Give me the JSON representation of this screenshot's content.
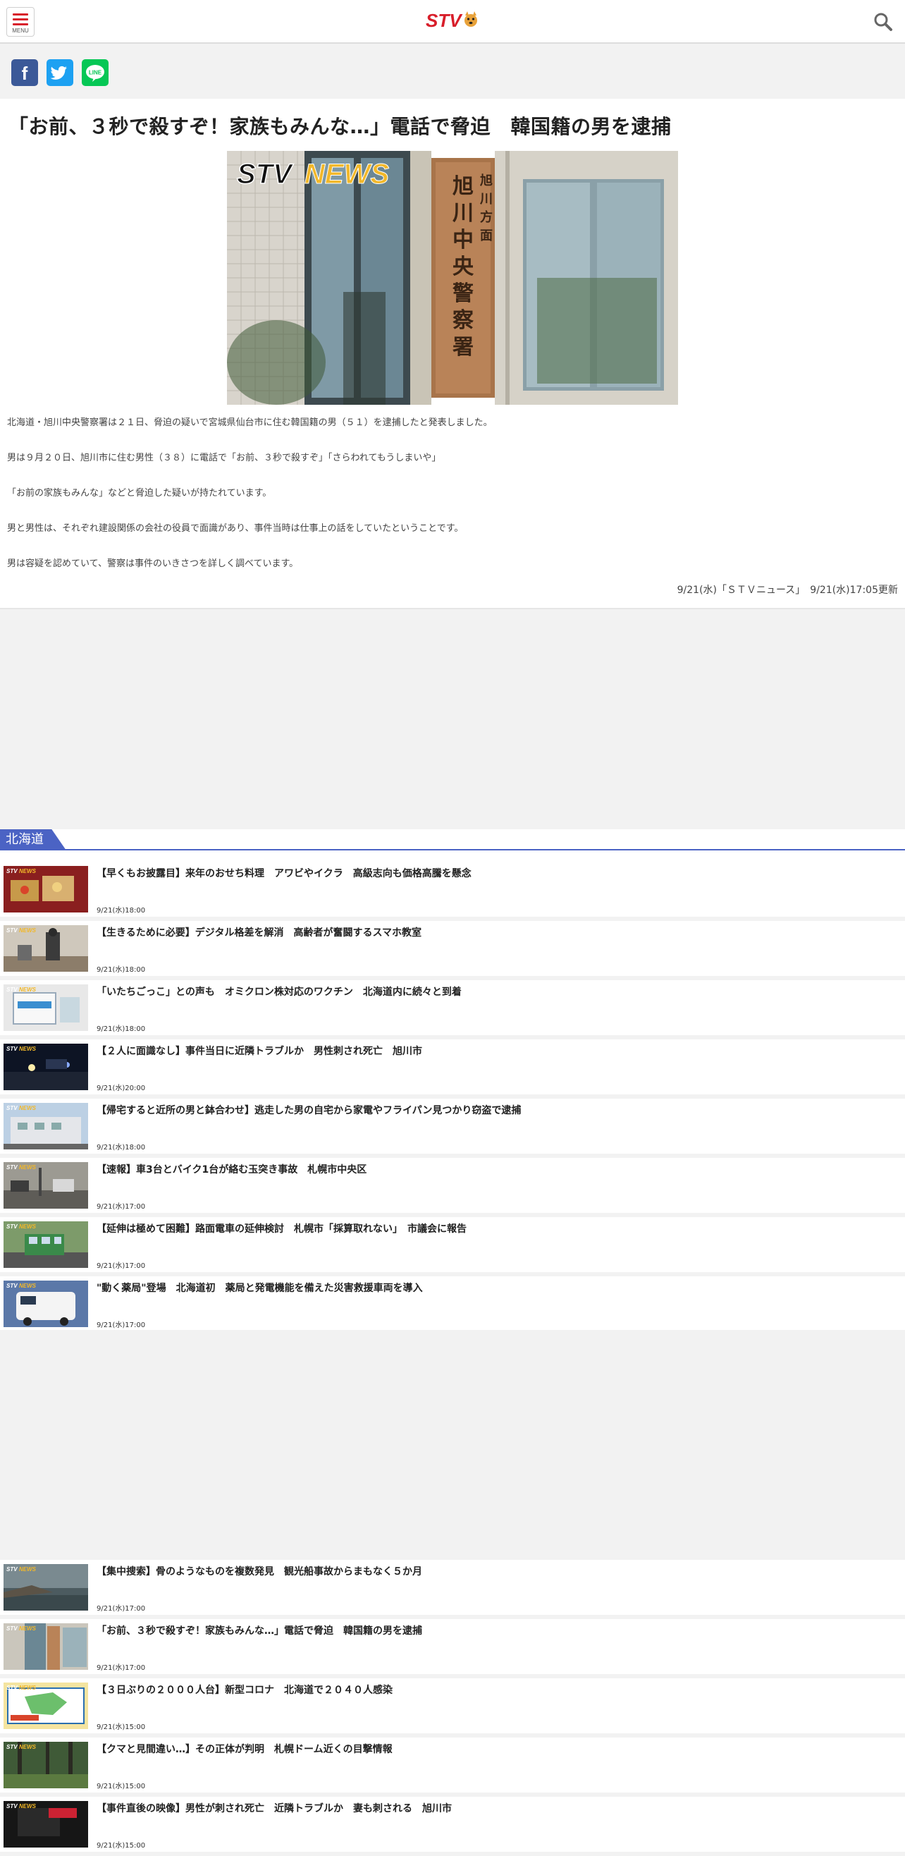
{
  "header": {
    "menu_label": "MENU",
    "logo_text": "STV"
  },
  "article": {
    "headline": "「お前、３秒で殺すぞ！家族もみんな…」電話で脅迫　韓国籍の男を逮捕",
    "hero_logo": "STV NEWS",
    "paragraphs": [
      "北海道・旭川中央警察署は２１日、脅迫の疑いで宮城県仙台市に住む韓国籍の男（５１）を逮捕したと発表しました。",
      "男は９月２０日、旭川市に住む男性（３８）に電話で「お前、３秒で殺すぞ」「さらわれてもうしまいや」",
      "「お前の家族もみんな」などと脅迫した疑いが持たれています。",
      "男と男性は、それぞれ建設関係の会社の役員で面識があり、事件当時は仕事上の話をしていたということです。",
      "男は容疑を認めていて、警察は事件のいきさつを詳しく調べています。"
    ],
    "updated": "9/21(水)「ＳＴＶニュース」　9/21(水)17:05更新"
  },
  "section": {
    "label": "北海道"
  },
  "news_list_1": [
    {
      "title": "【早くもお披露目】来年のおせち料理　アワビやイクラ　高級志向も価格高騰を懸念",
      "date": "9/21(水)18:00",
      "thumb": "osechi"
    },
    {
      "title": "【生きるために必要】デジタル格差を解消　高齢者が奮闘するスマホ教室",
      "date": "9/21(水)18:00",
      "thumb": "classroom"
    },
    {
      "title": "「いたちごっこ」との声も　オミクロン株対応のワクチン　北海道内に続々と到着",
      "date": "9/21(水)18:00",
      "thumb": "vaccine"
    },
    {
      "title": "【２人に面識なし】事件当日に近隣トラブルか　男性刺され死亡　旭川市",
      "date": "9/21(水)20:00",
      "thumb": "night"
    },
    {
      "title": "【帰宅すると近所の男と鉢合わせ】逃走した男の自宅から家電やフライパン見つかり窃盗で逮捕",
      "date": "9/21(水)18:00",
      "thumb": "building"
    },
    {
      "title": "【速報】車3台とバイク1台が絡む玉突き事故　札幌市中央区",
      "date": "9/21(水)17:00",
      "thumb": "street"
    },
    {
      "title": "【延伸は極めて困難】路面電車の延伸検討　札幌市「採算取れない」　市議会に報告",
      "date": "9/21(水)17:00",
      "thumb": "tram"
    },
    {
      "title": "\"動く薬局\"登場　北海道初　薬局と発電機能を備えた災害救援車両を導入",
      "date": "9/21(水)17:00",
      "thumb": "van"
    }
  ],
  "news_list_2": [
    {
      "title": "【集中捜索】骨のようなものを複数発見　観光船事故からまもなく５か月",
      "date": "9/21(水)17:00",
      "thumb": "sea"
    },
    {
      "title": "「お前、３秒で殺すぞ！家族もみんな…」電話で脅迫　韓国籍の男を逮捕",
      "date": "9/21(水)17:00",
      "thumb": "police"
    },
    {
      "title": "【３日ぶりの２０００人台】新型コロナ　北海道で２０４０人感染",
      "date": "9/21(水)15:00",
      "thumb": "map"
    },
    {
      "title": "【クマと見間違い…】その正体が判明　札幌ドーム近くの目撃情報",
      "date": "9/21(水)15:00",
      "thumb": "forest"
    },
    {
      "title": "【事件直後の映像】男性が刺され死亡　近隣トラブルか　妻も刺される　旭川市",
      "date": "9/21(水)15:00",
      "thumb": "dark"
    }
  ],
  "colors": {
    "brand_red": "#d81e2a",
    "section_blue": "#4b63c4",
    "facebook": "#3b5998",
    "twitter": "#1da1f2",
    "line": "#06c755"
  },
  "icons": {
    "menu": "hamburger-icon",
    "search": "search-icon",
    "facebook": "facebook-icon",
    "twitter": "twitter-icon",
    "line": "line-icon"
  }
}
